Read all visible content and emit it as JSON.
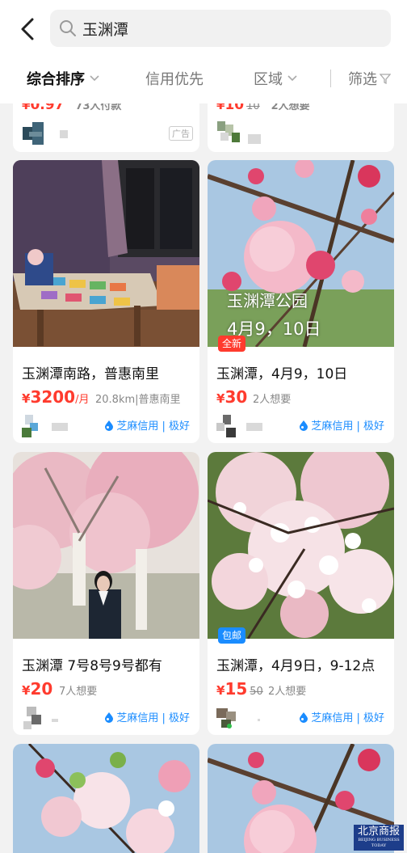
{
  "search": {
    "query": "玉渊潭"
  },
  "sort": {
    "items": [
      "综合排序",
      "信用优先",
      "区域",
      "筛选"
    ]
  },
  "top_partial": {
    "left": {
      "price_int": "0.97",
      "yen": "¥",
      "meta": "73人付款",
      "ad": "广告"
    },
    "right": {
      "price_int": "10",
      "yen": "¥",
      "orig": "10",
      "meta": "2人想要"
    }
  },
  "cards": [
    {
      "title": "玉渊潭南路，普惠南里",
      "yen": "¥",
      "price": "3200",
      "unit": "/月",
      "meta": "20.8km|普惠南里",
      "credit": "芝麻信用 | 极好",
      "tag": "",
      "overlay": ""
    },
    {
      "title": "玉渊潭，4月9，10日",
      "yen": "¥",
      "price": "30",
      "unit": "",
      "meta": "2人想要",
      "credit": "芝麻信用 | 极好",
      "tag": "全新",
      "overlay": "玉渊潭公园",
      "overlay2": "4月9，10日"
    },
    {
      "title": "玉渊潭  7号8号9号都有",
      "yen": "¥",
      "price": "20",
      "unit": "",
      "meta": "7人想要",
      "credit": "芝麻信用 | 极好",
      "tag": "",
      "overlay": ""
    },
    {
      "title": "玉渊潭，4月9日，9-12点",
      "yen": "¥",
      "price": "15",
      "orig": "50",
      "unit": "",
      "meta": "2人想要",
      "credit": "芝麻信用 | 极好",
      "tag": "包邮",
      "overlay": ""
    }
  ],
  "watermark": {
    "text": "北京商报",
    "sub": "BEIJING BUSINESS TODAY"
  },
  "colors": {
    "price": "#ff3b2e",
    "credit": "#1a8cff",
    "tag_new": "#ff3b2e",
    "tag_ship": "#1a8cff"
  }
}
